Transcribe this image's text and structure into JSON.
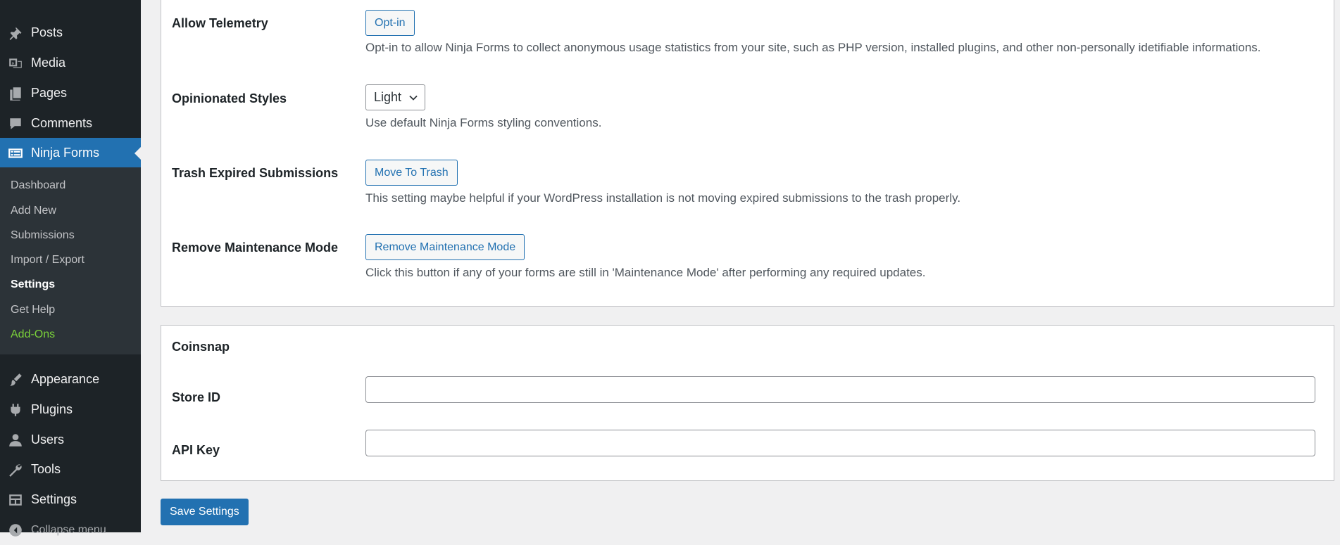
{
  "sidebar": {
    "menu": [
      {
        "label": "Posts",
        "icon": "pushpin-icon"
      },
      {
        "label": "Media",
        "icon": "media-icon"
      },
      {
        "label": "Pages",
        "icon": "pages-icon"
      },
      {
        "label": "Comments",
        "icon": "comment-icon"
      },
      {
        "label": "Ninja Forms",
        "icon": "forms-icon",
        "current": true
      }
    ],
    "submenu": [
      {
        "label": "Dashboard"
      },
      {
        "label": "Add New"
      },
      {
        "label": "Submissions"
      },
      {
        "label": "Import / Export"
      },
      {
        "label": "Settings",
        "active": true
      },
      {
        "label": "Get Help"
      },
      {
        "label": "Add-Ons",
        "accent": "#7ad03a"
      }
    ],
    "menu_bottom": [
      {
        "label": "Appearance",
        "icon": "paintbrush-icon"
      },
      {
        "label": "Plugins",
        "icon": "plugin-icon"
      },
      {
        "label": "Users",
        "icon": "user-icon"
      },
      {
        "label": "Tools",
        "icon": "wrench-icon"
      },
      {
        "label": "Settings",
        "icon": "settings-icon"
      },
      {
        "label": "Collapse menu",
        "icon": "collapse-icon"
      }
    ]
  },
  "advanced": {
    "telemetry": {
      "label": "Allow Telemetry",
      "button": "Opt-in",
      "description": "Opt-in to allow Ninja Forms to collect anonymous usage statistics from your site, such as PHP version, installed plugins, and other non-personally idetifiable informations."
    },
    "styles": {
      "label": "Opinionated Styles",
      "selected": "Light",
      "description": "Use default Ninja Forms styling conventions."
    },
    "trash": {
      "label": "Trash Expired Submissions",
      "button": "Move To Trash",
      "description": "This setting maybe helpful if your WordPress installation is not moving expired submissions to the trash properly."
    },
    "maintenance": {
      "label": "Remove Maintenance Mode",
      "button": "Remove Maintenance Mode",
      "description": "Click this button if any of your forms are still in 'Maintenance Mode' after performing any required updates."
    }
  },
  "coinsnap": {
    "title": "Coinsnap",
    "store_id_label": "Store ID",
    "store_id_value": "",
    "api_key_label": "API Key",
    "api_key_value": ""
  },
  "actions": {
    "save": "Save Settings"
  },
  "colors": {
    "sidebar_bg": "#1d2327",
    "submenu_bg": "#2c3338",
    "accent": "#2271b1",
    "addons": "#7ad03a"
  }
}
